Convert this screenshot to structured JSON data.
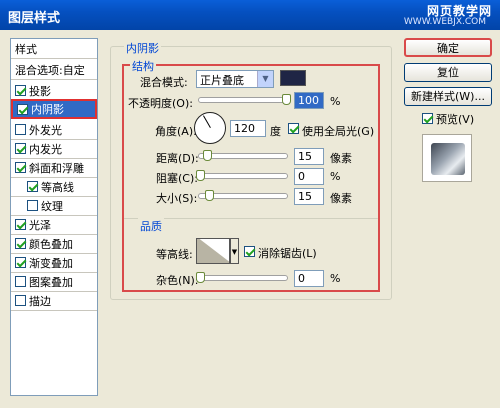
{
  "window": {
    "title": "图层样式",
    "watermark_text": "网页教学网",
    "watermark_url": "WWW.WEBJX.COM"
  },
  "sidebar": {
    "header": "样式",
    "blend": "混合选项:自定",
    "items": [
      {
        "label": "投影",
        "checked": true
      },
      {
        "label": "内阴影",
        "checked": true,
        "selected": true
      },
      {
        "label": "外发光",
        "checked": false
      },
      {
        "label": "内发光",
        "checked": true
      },
      {
        "label": "斜面和浮雕",
        "checked": true
      },
      {
        "label": "等高线",
        "checked": true
      },
      {
        "label": "纹理",
        "checked": false
      },
      {
        "label": "光泽",
        "checked": true
      },
      {
        "label": "颜色叠加",
        "checked": true
      },
      {
        "label": "渐变叠加",
        "checked": true
      },
      {
        "label": "图案叠加",
        "checked": false
      },
      {
        "label": "描边",
        "checked": false
      }
    ]
  },
  "panel": {
    "group_title": "内阴影",
    "structure_title": "结构",
    "blend_mode_label": "混合模式:",
    "blend_mode_value": "正片叠底",
    "shadow_color": "#1f2545",
    "opacity_label": "不透明度(O):",
    "opacity_value": "100",
    "opacity_unit": "%",
    "angle_label": "角度(A):",
    "angle_value": "120",
    "angle_unit": "度",
    "global_light_label": "使用全局光(G)",
    "global_light_checked": true,
    "distance_label": "距离(D):",
    "distance_value": "15",
    "distance_unit": "像素",
    "choke_label": "阻塞(C):",
    "choke_value": "0",
    "choke_unit": "%",
    "size_label": "大小(S):",
    "size_value": "15",
    "size_unit": "像素",
    "quality_title": "品质",
    "contour_label": "等高线:",
    "antialias_label": "消除锯齿(L)",
    "antialias_checked": true,
    "noise_label": "杂色(N):",
    "noise_value": "0",
    "noise_unit": "%"
  },
  "buttons": {
    "ok": "确定",
    "reset": "复位",
    "new_style": "新建样式(W)...",
    "preview_label": "预览(V)",
    "preview_checked": true
  }
}
